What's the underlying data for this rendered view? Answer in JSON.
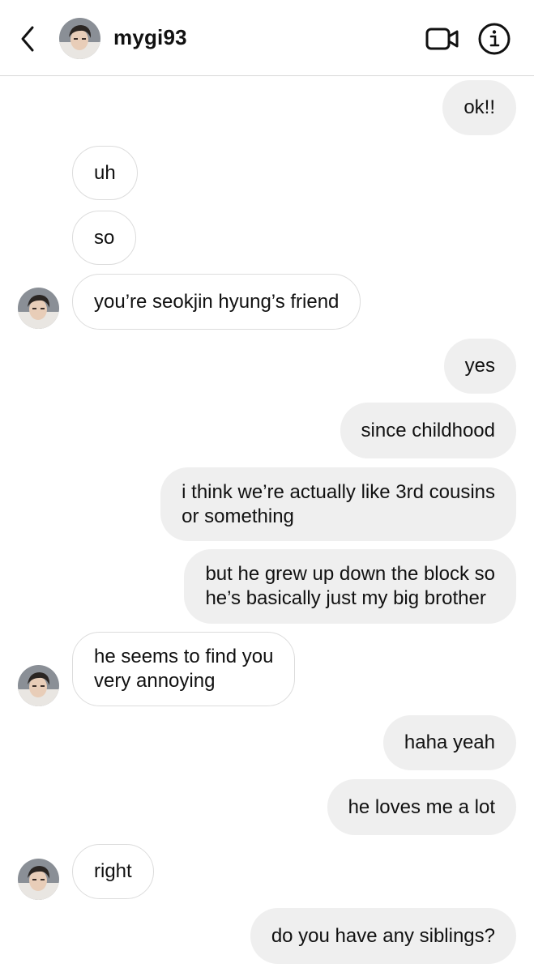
{
  "header": {
    "username": "mygi93",
    "back_icon": "chevron-left-icon",
    "avatar_icon": "profile-avatar",
    "video_icon": "video-camera-icon",
    "info_icon": "info-icon"
  },
  "messages": [
    {
      "from": "me",
      "text": "ok!!"
    },
    {
      "from": "them",
      "text": "uh"
    },
    {
      "from": "them",
      "text": "so"
    },
    {
      "from": "them",
      "text": "you’re seokjin hyung’s friend"
    },
    {
      "from": "me",
      "text": "yes"
    },
    {
      "from": "me",
      "text": "since childhood"
    },
    {
      "from": "me",
      "text": "i think we’re actually like 3rd cousins\nor something"
    },
    {
      "from": "me",
      "text": "but he grew up down the block so\nhe’s basically just my big brother"
    },
    {
      "from": "them",
      "text": "he seems to find you\nvery annoying"
    },
    {
      "from": "me",
      "text": "haha yeah"
    },
    {
      "from": "me",
      "text": "he loves me a lot"
    },
    {
      "from": "them",
      "text": "right"
    },
    {
      "from": "me",
      "text": "do you have any siblings?"
    }
  ],
  "colors": {
    "outgoing_bubble": "#efefef",
    "incoming_border": "#dcdcdc",
    "text": "#111111"
  }
}
